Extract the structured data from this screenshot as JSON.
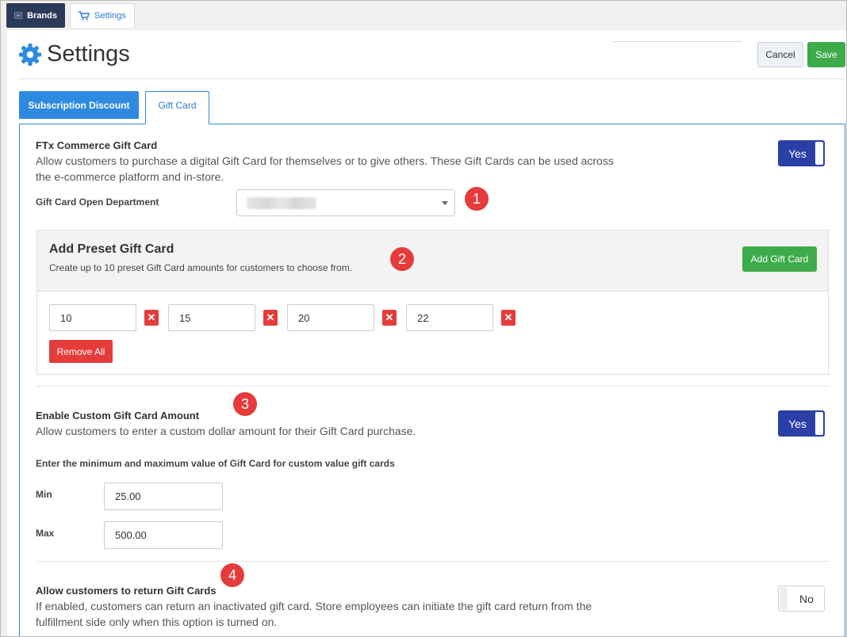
{
  "top_tabs": {
    "brands": "Brands",
    "settings": "Settings"
  },
  "header": {
    "title": "Settings",
    "cancel_label": "Cancel",
    "save_label": "Save"
  },
  "tabs": {
    "subscription_discount": "Subscription Discount",
    "gift_card": "Gift Card"
  },
  "gift_card": {
    "title": "FTx Commerce Gift Card",
    "description": "Allow customers to purchase a digital Gift Card for themselves or to give others. These Gift Cards can be used across the e-commerce platform and in-store.",
    "toggle": "Yes",
    "department_label": "Gift Card Open Department"
  },
  "preset": {
    "title": "Add Preset Gift Card",
    "description": "Create up to 10 preset Gift Card amounts for customers to choose from.",
    "add_button": "Add Gift Card",
    "amounts": [
      "10",
      "15",
      "20",
      "22"
    ],
    "remove_all": "Remove All"
  },
  "custom_amount": {
    "title": "Enable Custom Gift Card Amount",
    "description": "Allow customers to enter a custom dollar amount for their Gift Card purchase.",
    "toggle": "Yes",
    "range_label": "Enter the minimum and maximum value of Gift Card for custom value gift cards",
    "min_label": "Min",
    "min_value": "25.00",
    "max_label": "Max",
    "max_value": "500.00"
  },
  "returns": {
    "title": "Allow customers to return Gift Cards",
    "description": "If enabled, customers can return an inactivated gift card. Store employees can initiate the gift card return from the fulfillment side only when this option is turned on.",
    "toggle": "No"
  },
  "markers": [
    "1",
    "2",
    "3",
    "4"
  ],
  "colors": {
    "primary": "#2d8ae0",
    "toggle": "#2b3fa6",
    "success": "#3eab4a",
    "danger": "#e63b3b"
  }
}
